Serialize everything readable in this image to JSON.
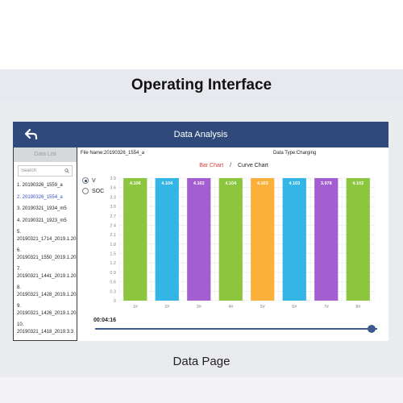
{
  "page": {
    "heading": "Operating Interface",
    "caption": "Data Page"
  },
  "app": {
    "header_title": "Data Analysis",
    "back_icon": "back-arrow-icon",
    "header_color": "#2f4a7a"
  },
  "sidebar": {
    "header": "Data List",
    "search_placeholder": "Search",
    "items": [
      {
        "label": "1.  20190326_1559_a",
        "active": false
      },
      {
        "label": "2.  20190326_1554_a",
        "active": true
      },
      {
        "label": "3.  20190321_1934_m5",
        "active": false
      },
      {
        "label": "4.  20190321_1923_m5",
        "active": false
      },
      {
        "label": "5.  20190321_1714_2019.1.20",
        "active": false
      },
      {
        "label": "6.  20190321_1550_2019.1.20",
        "active": false
      },
      {
        "label": "7.  20190321_1441_2019.1.20",
        "active": false
      },
      {
        "label": "8.  20190321_1428_2019.1.20",
        "active": false
      },
      {
        "label": "9.  20190321_1426_2019.1.20",
        "active": false
      },
      {
        "label": "10.  20190321_1418_2019.3.3",
        "active": false
      }
    ]
  },
  "main": {
    "file_name": "File Name:20190326_1554_a",
    "data_type": "Data Type:Charging",
    "tabs": {
      "bar": "Bar Chart",
      "separator": "/",
      "curve": "Curve Chart"
    },
    "radios": [
      {
        "label": "V",
        "checked": true
      },
      {
        "label": "SOC",
        "checked": false
      }
    ],
    "time": "00:04:16",
    "playback_progress": 0.98
  },
  "chart_data": {
    "type": "bar",
    "categories": [
      "1#",
      "2#",
      "3#",
      "4#",
      "5#",
      "6#",
      "7#",
      "8#"
    ],
    "values": [
      4.106,
      4.104,
      4.102,
      4.104,
      4.103,
      4.103,
      3.978,
      4.102
    ],
    "data_labels": [
      "4.106",
      "4.104",
      "4.102",
      "4.104",
      "4.103",
      "4.103",
      "3.978",
      "4.102"
    ],
    "bar_colors": [
      "#8cc63f",
      "#33b5e5",
      "#a35fd1",
      "#8cc63f",
      "#fbb03b",
      "#33b5e5",
      "#a35fd1",
      "#8cc63f"
    ],
    "y_ticks": [
      "3.9",
      "3.6",
      "3.3",
      "3.0",
      "2.7",
      "2.4",
      "2.1",
      "1.8",
      "1.5",
      "1.2",
      "0.9",
      "0.6",
      "0.3",
      "0"
    ],
    "ylim": [
      0,
      3.9
    ],
    "grid": true
  }
}
